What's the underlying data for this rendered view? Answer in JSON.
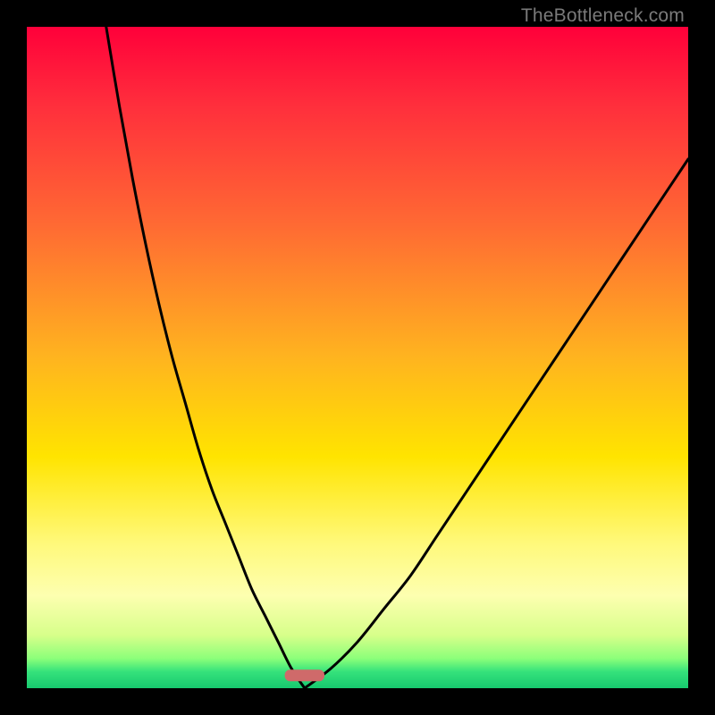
{
  "watermark": "TheBottleneck.com",
  "colors": {
    "border": "#000000",
    "curve": "#000000",
    "marker": "#cf6a6a",
    "gradient_stops": [
      {
        "offset": 0.0,
        "color": "#ff003a"
      },
      {
        "offset": 0.12,
        "color": "#ff2f3c"
      },
      {
        "offset": 0.3,
        "color": "#ff6a33"
      },
      {
        "offset": 0.5,
        "color": "#ffb41f"
      },
      {
        "offset": 0.65,
        "color": "#ffe400"
      },
      {
        "offset": 0.78,
        "color": "#fff97a"
      },
      {
        "offset": 0.86,
        "color": "#fdffb0"
      },
      {
        "offset": 0.92,
        "color": "#d7ff8a"
      },
      {
        "offset": 0.955,
        "color": "#8cff7a"
      },
      {
        "offset": 0.975,
        "color": "#35e27b"
      },
      {
        "offset": 1.0,
        "color": "#17c96f"
      }
    ]
  },
  "chart_data": {
    "type": "line",
    "title": "",
    "xlabel": "",
    "ylabel": "",
    "xlim": [
      0,
      100
    ],
    "ylim": [
      0,
      100
    ],
    "x_apex": 42,
    "marker": {
      "x_center": 42,
      "width_pct": 6,
      "y": 2
    },
    "series": [
      {
        "name": "left-branch",
        "x": [
          12,
          14,
          16,
          18,
          20,
          22,
          24,
          26,
          28,
          30,
          32,
          34,
          36,
          38,
          40,
          42
        ],
        "values": [
          100,
          88,
          77,
          67,
          58,
          50,
          43,
          36,
          30,
          25,
          20,
          15,
          11,
          7,
          3,
          0
        ]
      },
      {
        "name": "right-branch",
        "x": [
          42,
          46,
          50,
          54,
          58,
          62,
          66,
          70,
          74,
          78,
          82,
          86,
          90,
          94,
          98,
          100
        ],
        "values": [
          0,
          3,
          7,
          12,
          17,
          23,
          29,
          35,
          41,
          47,
          53,
          59,
          65,
          71,
          77,
          80
        ]
      }
    ]
  }
}
